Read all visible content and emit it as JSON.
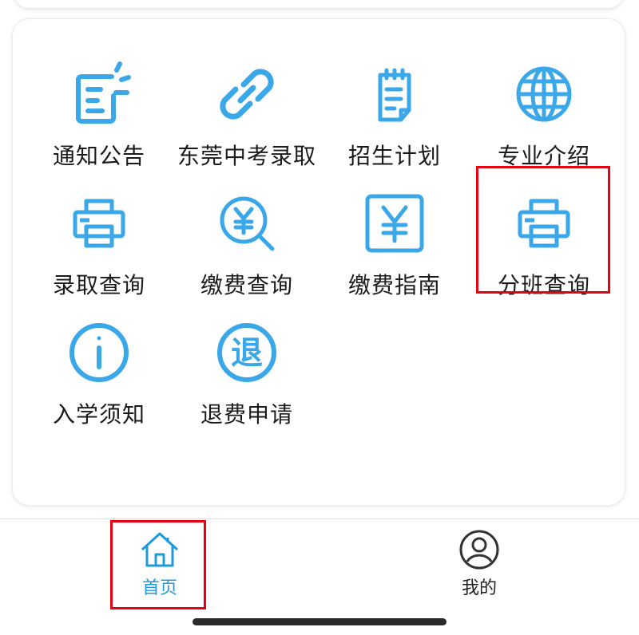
{
  "colors": {
    "accent": "#3aa7e8",
    "highlight": "#e60012",
    "tab_active": "#1d9bd8"
  },
  "tiles": [
    {
      "label": "通知公告",
      "icon": "notice-document-icon"
    },
    {
      "label": "东莞中考录取",
      "icon": "link-chain-icon"
    },
    {
      "label": "招生计划",
      "icon": "clipboard-plan-icon"
    },
    {
      "label": "专业介绍",
      "icon": "globe-icon"
    },
    {
      "label": "录取查询",
      "icon": "printer-icon"
    },
    {
      "label": "缴费查询",
      "icon": "yuan-search-icon"
    },
    {
      "label": "缴费指南",
      "icon": "yuan-box-icon"
    },
    {
      "label": "分班查询",
      "icon": "printer-icon"
    },
    {
      "label": "入学须知",
      "icon": "info-circle-icon"
    },
    {
      "label": "退费申请",
      "icon": "refund-circle-icon",
      "glyph": "退"
    }
  ],
  "tabbar": {
    "home_label": "首页",
    "me_label": "我的"
  }
}
